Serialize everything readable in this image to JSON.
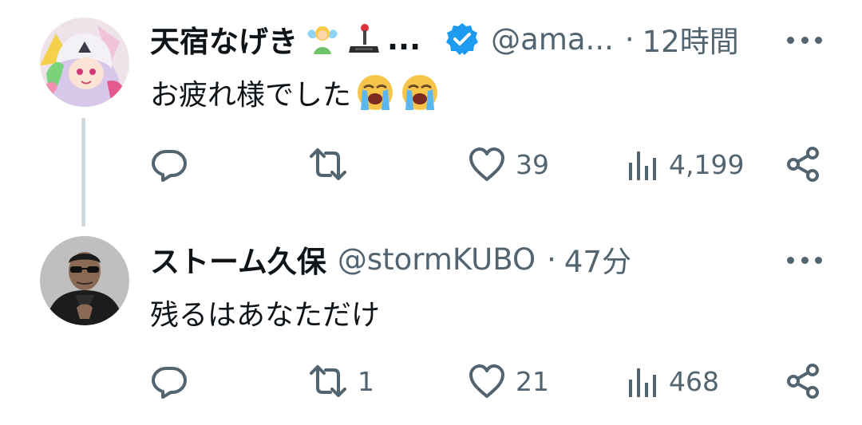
{
  "colors": {
    "text_primary": "#0f1419",
    "text_secondary": "#536471",
    "verified_blue": "#1d9bf0",
    "thread_line": "#cfd9de"
  },
  "tweets": [
    {
      "avatar_icon": "anime-character-avatar",
      "name": "天宿なげき",
      "name_emojis": [
        "fairy-emoji",
        "joystick-emoji"
      ],
      "name_truncation": "...",
      "verified": true,
      "handle": "@ama...",
      "separator": "·",
      "time": "12時間",
      "text": "お疲れ様でした",
      "text_emojis": [
        "loudly-crying-face-emoji",
        "loudly-crying-face-emoji"
      ],
      "actions": {
        "reply": "",
        "retweet": "",
        "like": "39",
        "views": "4,199"
      }
    },
    {
      "avatar_icon": "man-in-sunglasses-avatar",
      "name": "ストーム久保",
      "handle": "@stormKUBO",
      "separator": "·",
      "time": "47分",
      "text": "残るはあなただけ",
      "actions": {
        "reply": "",
        "retweet": "1",
        "like": "21",
        "views": "468"
      }
    }
  ]
}
